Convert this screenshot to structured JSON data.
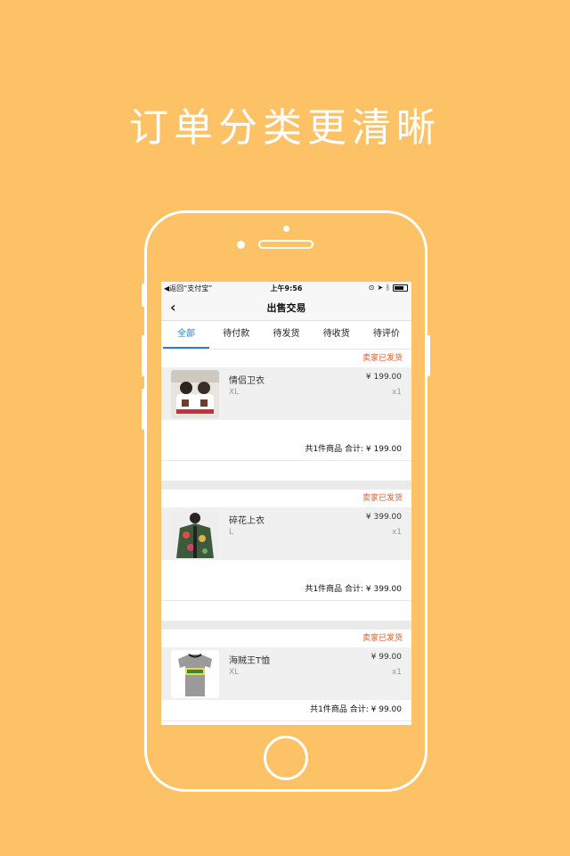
{
  "headline": "订单分类更清晰",
  "status_bar": {
    "back_app": "◀返回“支付宝”",
    "time": "上午9:56",
    "icons": [
      "lock-rotation-icon",
      "location-icon",
      "bluetooth-icon",
      "battery-icon"
    ]
  },
  "nav": {
    "back_icon": "chevron-left-icon",
    "title": "出售交易"
  },
  "tabs": [
    {
      "label": "全部",
      "active": true
    },
    {
      "label": "待付款",
      "active": false
    },
    {
      "label": "待发货",
      "active": false
    },
    {
      "label": "待收货",
      "active": false
    },
    {
      "label": "待评价",
      "active": false
    }
  ],
  "orders": [
    {
      "status": "卖家已发货",
      "name": "情侣卫衣",
      "size": "XL",
      "price": "¥ 199.00",
      "qty": "x1",
      "summary": "共1件商品 合计: ¥ 199.00"
    },
    {
      "status": "卖家已发货",
      "name": "碎花上衣",
      "size": "L",
      "price": "¥ 399.00",
      "qty": "x1",
      "summary": "共1件商品 合计: ¥ 399.00"
    },
    {
      "status": "卖家已发货",
      "name": "海贼王T恤",
      "size": "XL",
      "price": "¥ 99.00",
      "qty": "x1",
      "summary": "共1件商品 合计: ¥ 99.00"
    }
  ],
  "colors": {
    "background": "#fec266",
    "accent": "#2e7ccb",
    "status": "#ee5a2a"
  }
}
